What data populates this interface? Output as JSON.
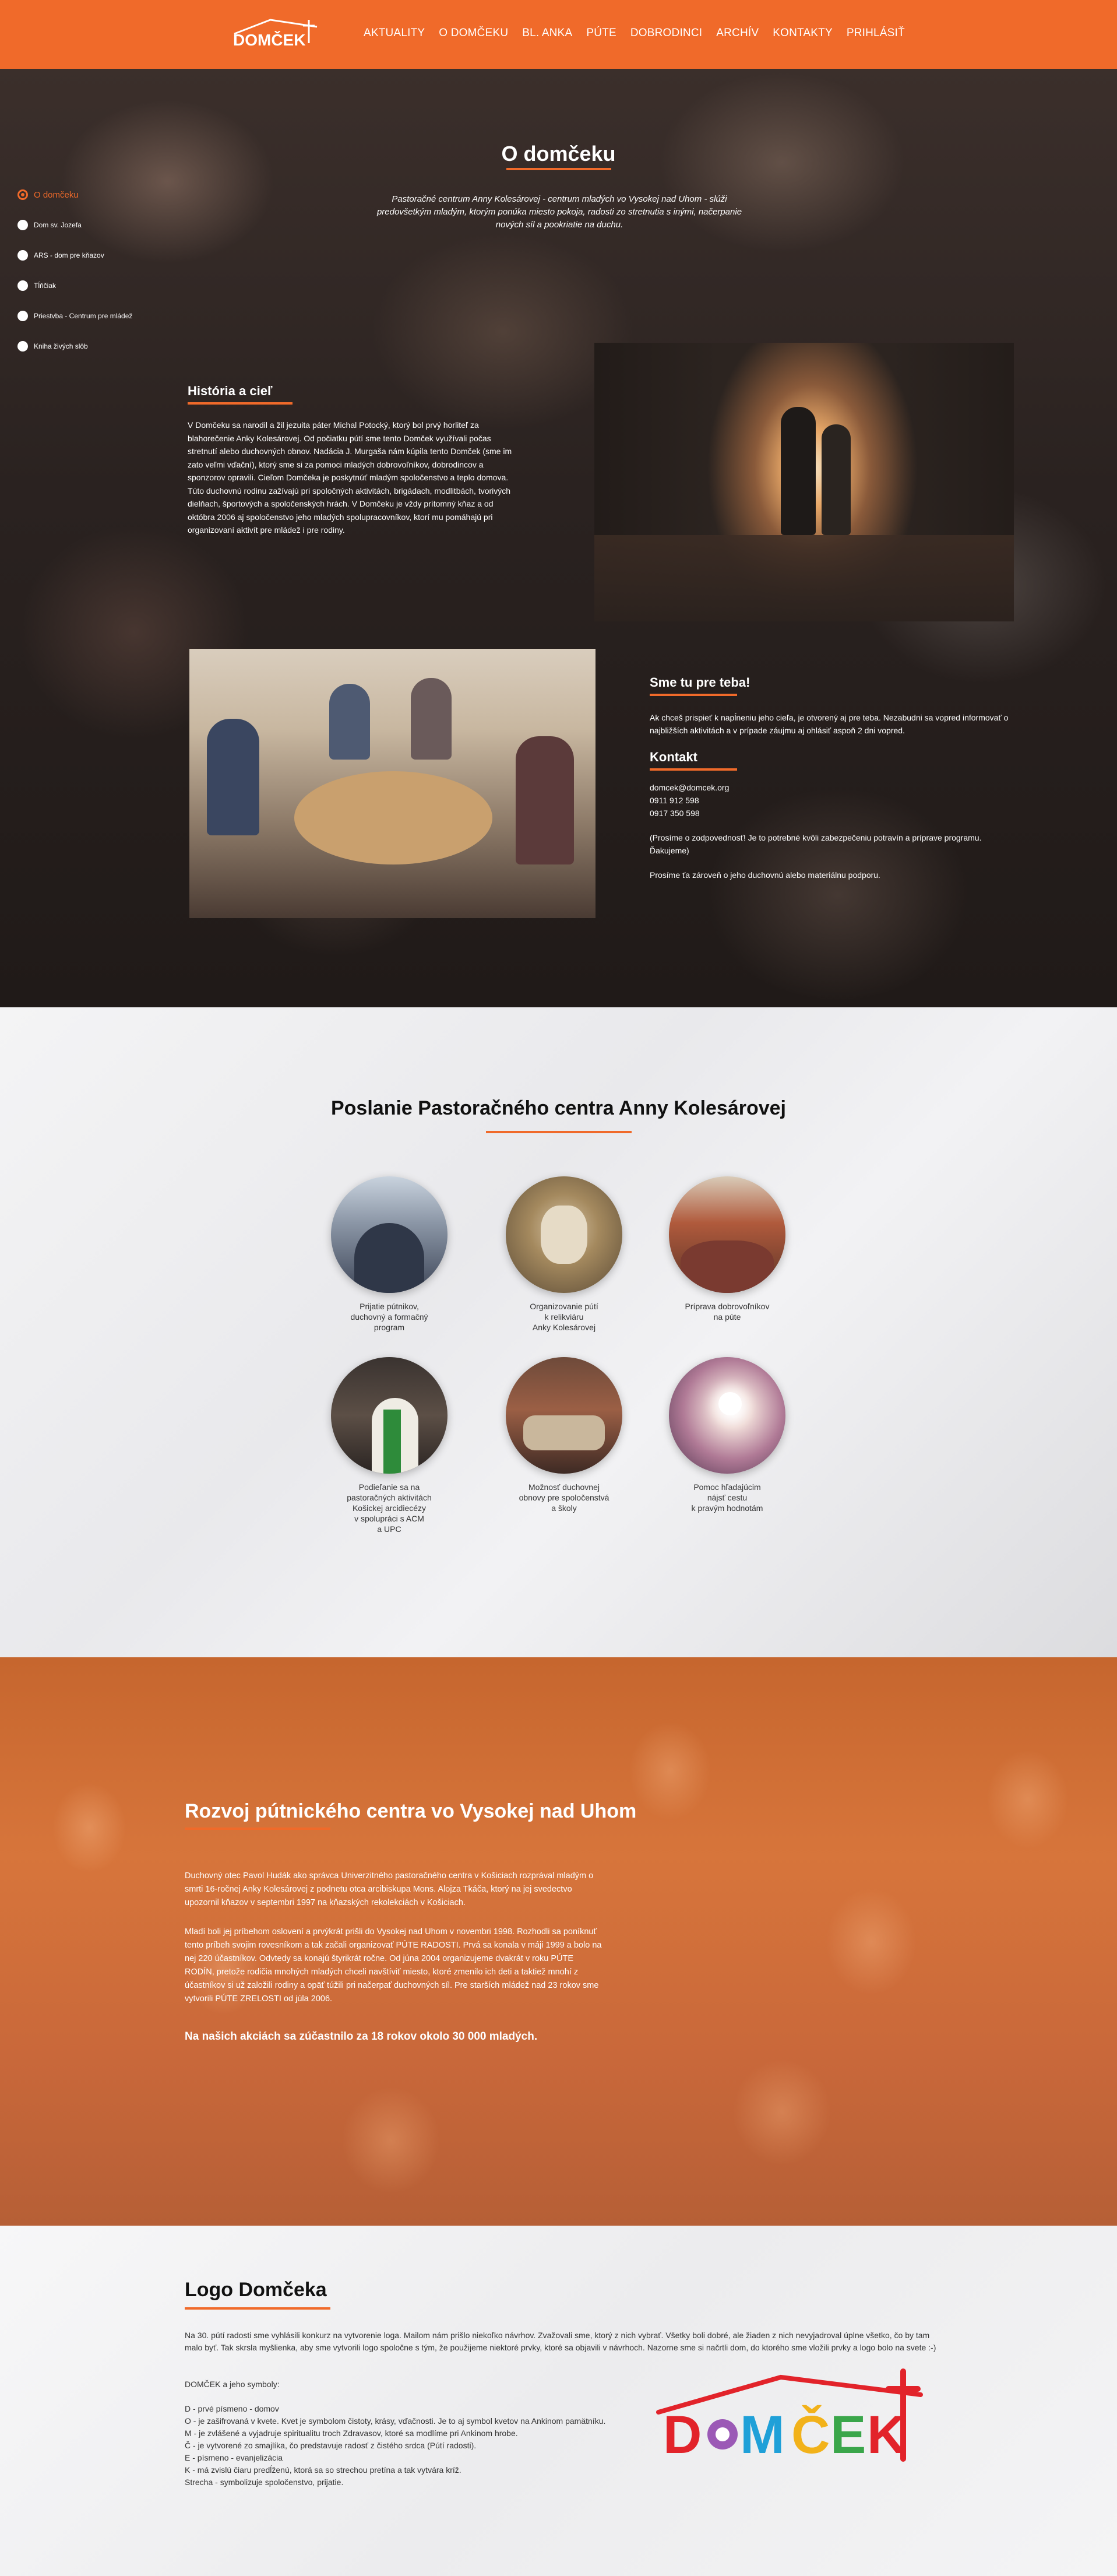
{
  "colors": {
    "accent": "#f06a2a",
    "nav_bg": "#f06a2a",
    "hero_text": "#ffffff"
  },
  "nav": {
    "logo_text": "DOMČEK",
    "items": [
      "AKTUALITY",
      "O DOMČEKU",
      "BL. ANKA",
      "PÚTE",
      "DOBRODINCI",
      "ARCHÍV",
      "KONTAKTY",
      "PRIHLÁSIŤ"
    ]
  },
  "side_nav": {
    "items": [
      {
        "label": "O domčeku",
        "active": true
      },
      {
        "label": "Dom sv. Jozefa",
        "active": false
      },
      {
        "label": "ARS - dom pre kňazov",
        "active": false
      },
      {
        "label": "Tĺňčiak",
        "active": false
      },
      {
        "label": "Priestvba - Centrum pre mládež",
        "active": false
      },
      {
        "label": "Kniha živých slôb",
        "active": false
      }
    ]
  },
  "hero": {
    "title": "O domčeku",
    "intro": "Pastoračné centrum Anny Kolesárovej - centrum mladých vo Vysokej nad Uhom - slúži predovšetkým mladým, ktorým ponúka miesto pokoja, radosti zo stretnutia s inými, načerpanie nových síl a pookriatie na duchu."
  },
  "history": {
    "title": "História a cieľ",
    "text": "V Domčeku sa narodil a žil jezuita páter Michal Potocký, ktorý bol prvý horliteľ za blahorečenie Anky Kolesárovej. Od počiatku pútí sme tento Domček využívali počas stretnutí alebo duchovných obnov. Nadácia J. Murgaša nám kúpila tento Domček (sme im zato veľmi vďační), ktorý sme si za pomoci mladých dobrovoľníkov, dobrodincov a sponzorov opravili. Cieľom Domčeka je poskytnúť mladým spoločenstvo a teplo domova. Túto duchovnú rodinu zažívajú pri spoločných aktivitách, brigádach, modlitbách, tvorivých dielňach, športových a spoločenských hrách. V Domčeku je vždy prítomný kňaz a od októbra 2006 aj spoločenstvo jeho mladých spolupracovníkov, ktorí mu pomáhajú pri organizovaní aktivít pre mládež i pre rodiny."
  },
  "join": {
    "title": "Sme tu pre teba!",
    "text": "Ak chceš prispieť k napĺneniu jeho cieľa, je otvorený aj pre teba. Nezabudni sa vopred informovať o najbližších aktivitách a v prípade záujmu aj ohlásiť aspoň 2 dni vopred."
  },
  "contact": {
    "title": "Kontakt",
    "lines": [
      "domcek@domcek.org",
      "0911 912 598",
      "0917 350 598"
    ],
    "note": "(Prosíme o zodpovednosť! Je to potrebné kvôli zabezpečeniu potravín a príprave programu. Ďakujeme)",
    "note2": "Prosíme ťa zároveň o jeho duchovnú alebo materiálnu podporu."
  },
  "mission": {
    "title": "Poslanie Pastoračného centra Anny Kolesárovej",
    "items": [
      {
        "caption": "Prijatie pútnikov,\nduchovný a formačný\nprogram"
      },
      {
        "caption": "Organizovanie pútí\nk relikviáru\nAnky Kolesárovej"
      },
      {
        "caption": "Príprava dobrovoľníkov\nna púte"
      },
      {
        "caption": "Podieľanie sa na\npastoračných aktivitách\nKošickej arcidiecézy\nv spolupráci s ACM\na UPC"
      },
      {
        "caption": "Možnosť duchovnej\nobnovy pre spoločenstvá\na školy"
      },
      {
        "caption": "Pomoc hľadajúcim\nnájsť cestu\nk pravým hodnotám"
      }
    ]
  },
  "development": {
    "title": "Rozvoj pútnického centra vo Vysokej nad Uhom",
    "p1": "Duchovný otec Pavol Hudák ako správca Univerzitného pastoračného centra v Košiciach rozprával mladým o smrti 16-ročnej Anky Kolesárovej z podnetu otca arcibiskupa Mons. Alojza Tkáča, ktorý na jej svedectvo upozornil kňazov v septembri 1997 na kňazských rekolekciách v Košiciach.",
    "p2": "Mladí boli jej príbehom oslovení a prvýkrát prišli do Vysokej nad Uhom v novembri 1998. Rozhodli sa poníknuť tento príbeh svojim rovesníkom a tak začali organizovať PÚTE RADOSTI. Prvá sa konala v máji 1999 a bolo na nej 220 účastníkov. Odvtedy sa konajú štyrikrát ročne. Od júna 2004 organizujeme dvakrát v roku PÚTE RODÍN, pretože rodičia mnohých mladých chceli navštíviť miesto, ktoré zmenilo ich deti a taktiež mnohí z účastníkov si už založili rodiny a opäť túžili pri načerpať duchovných síl. Pre starších mládež nad 23 rokov sme vytvorili PÚTE ZRELOSTI od júla 2006.",
    "strong": "Na našich akciách sa zúčastnilo za 18 rokov okolo 30 000 mladých."
  },
  "logo_section": {
    "title": "Logo Domčeka",
    "intro": "Na 30. pútí radosti sme vyhlásili konkurz na vytvorenie loga. Mailom nám prišlo niekoľko návrhov. Zvažovali sme, ktorý z nich vybrať. Všetky boli dobré, ale žiaden z nich nevyjadroval úplne všetko, čo by tam malo byť. Tak skrsla myšlienka, aby sme vytvorili logo spoločne s tým, že použijeme niektoré prvky, ktoré sa objavili v návrhoch. Nazorne sme si načrtli dom, do ktorého sme vložili prvky a logo bolo na svete :-)",
    "symbols_title": "DOMČEK a jeho symboly:",
    "symbols": [
      "D - prvé písmeno - domov",
      "O - je zašifrovaná v kvete. Kvet je symbolom čistoty, krásy, vďačnosti. Je to aj symbol kvetov na Ankinom pamätníku.",
      "M - je zvlášené a vyjadruje spiritualitu troch Zdravasov, ktoré sa modlíme pri Ankinom hrobe.",
      "Č - je vytvorené zo smajlíka, čo predstavuje radosť z čistého srdca (Pútí radosti).",
      "E - písmeno - evanjelizácia",
      "K - má zvislú čiaru predĺženú, ktorá sa so strechou pretína a tak vytvára kríž.",
      "Strecha - symbolizuje spoločenstvo, prijatie."
    ],
    "logo_text": "DOMČEK"
  }
}
